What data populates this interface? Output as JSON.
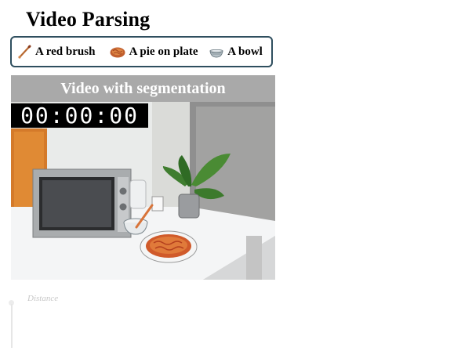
{
  "page": {
    "title": "Video Parsing"
  },
  "legend": {
    "items": [
      {
        "label": "A red brush",
        "icon": "brush-icon",
        "color": "#c0622d"
      },
      {
        "label": "A pie on plate",
        "icon": "pie-icon",
        "color": "#c45a2c"
      },
      {
        "label": "A bowl",
        "icon": "bowl-icon",
        "color": "#8a9aa3"
      }
    ],
    "border_color": "#2f4f5f"
  },
  "video": {
    "header": "Video with segmentation",
    "timer": "00:00:00",
    "image": "kitchen-counter-scene"
  },
  "plot": {
    "label": "Distance"
  }
}
